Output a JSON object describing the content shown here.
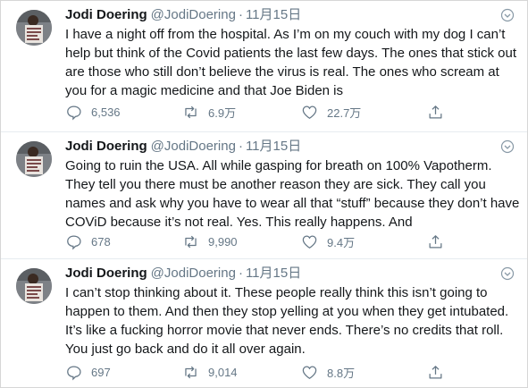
{
  "colors": {
    "text": "#14171a",
    "muted": "#657786",
    "divider": "#e6ecf0"
  },
  "tweets": [
    {
      "name": "Jodi Doering",
      "handle": "@JodiDoering",
      "separator": "·",
      "date": "11月15日",
      "text": "I have a night off from the hospital. As I’m on my couch with my dog I can’t help but think of the Covid patients the last few days. The ones that stick out are those who still don’t believe the virus is real. The ones who scream at you for a magic medicine and that Joe Biden is",
      "replies": "6,536",
      "retweets": "6.9万",
      "likes": "22.7万"
    },
    {
      "name": "Jodi Doering",
      "handle": "@JodiDoering",
      "separator": "·",
      "date": "11月15日",
      "text": "Going to ruin the USA. All while gasping for breath on 100% Vapotherm. They tell you there must be another reason they are sick. They call you names and ask why you have to wear all that “stuff” because they don’t have COViD because it’s not real. Yes. This really happens. And",
      "replies": "678",
      "retweets": "9,990",
      "likes": "9.4万"
    },
    {
      "name": "Jodi Doering",
      "handle": "@JodiDoering",
      "separator": "·",
      "date": "11月15日",
      "text": "I can’t stop thinking about it. These people really think this isn’t going to happen to them.  And then they stop yelling at you when they get intubated. It’s like a fucking horror movie that never ends. There’s no credits that roll. You just go back and do it all over again.",
      "replies": "697",
      "retweets": "9,014",
      "likes": "8.8万"
    }
  ]
}
